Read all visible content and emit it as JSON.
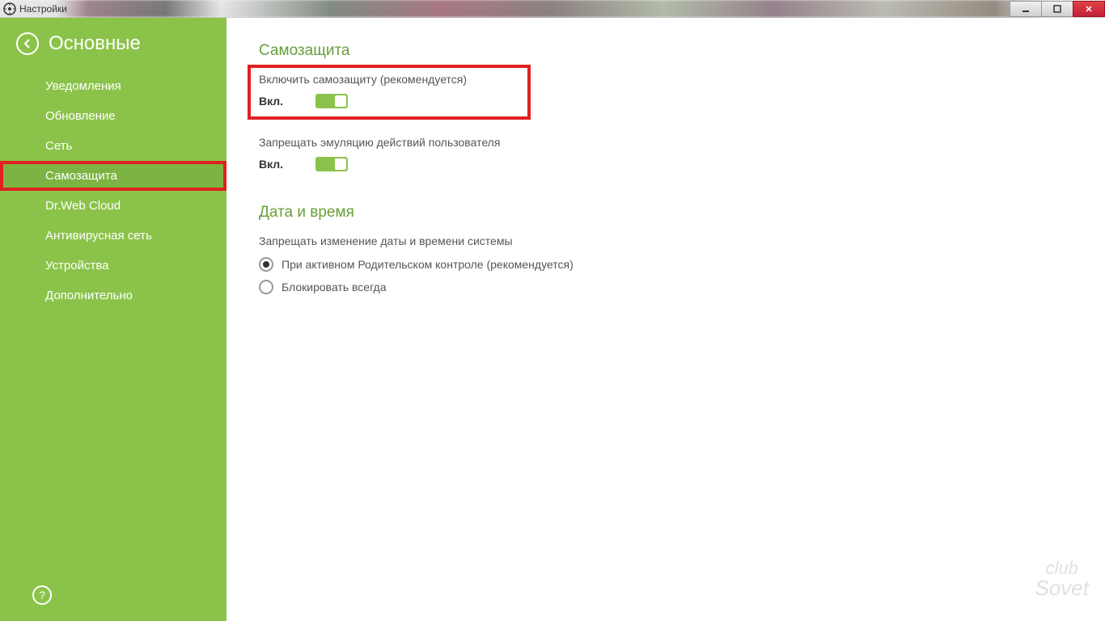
{
  "window": {
    "title": "Настройки"
  },
  "sidebar": {
    "title": "Основные",
    "items": [
      {
        "label": "Уведомления"
      },
      {
        "label": "Обновление"
      },
      {
        "label": "Сеть"
      },
      {
        "label": "Самозащита"
      },
      {
        "label": "Dr.Web Cloud"
      },
      {
        "label": "Антивирусная сеть"
      },
      {
        "label": "Устройства"
      },
      {
        "label": "Дополнительно"
      }
    ],
    "help": "?"
  },
  "main": {
    "section1": {
      "title": "Самозащита",
      "setting1": {
        "label": "Включить самозащиту (рекомендуется)",
        "state": "Вкл."
      },
      "setting2": {
        "label": "Запрещать эмуляцию действий пользователя",
        "state": "Вкл."
      }
    },
    "section2": {
      "title": "Дата и время",
      "label": "Запрещать изменение даты и времени системы",
      "radio1": "При активном Родительском контроле (рекомендуется)",
      "radio2": "Блокировать всегда"
    }
  },
  "watermark": {
    "line1": "club",
    "line2": "Sovet"
  }
}
